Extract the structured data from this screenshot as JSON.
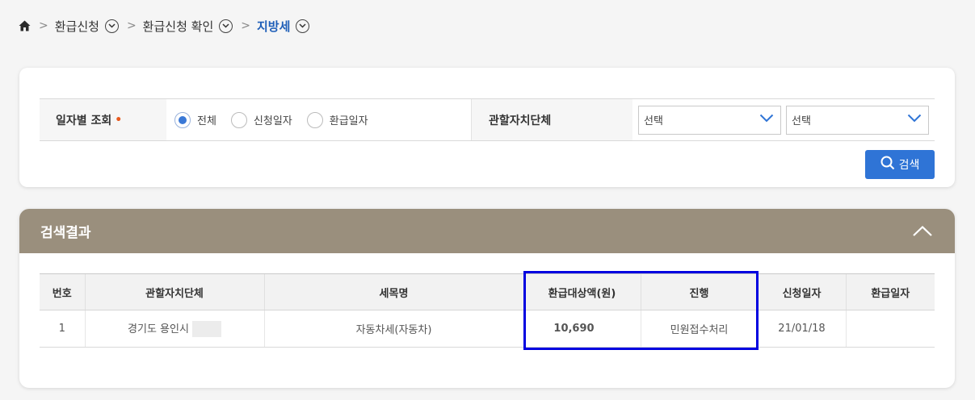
{
  "breadcrumb": {
    "home_icon": "home-icon",
    "items": [
      {
        "label": "환급신청"
      },
      {
        "label": "환급신청 확인"
      },
      {
        "label": "지방세"
      }
    ]
  },
  "search": {
    "date_label": "일자별 조회",
    "required_mark": "•",
    "radios": [
      {
        "label": "전체",
        "checked": true
      },
      {
        "label": "신청일자",
        "checked": false
      },
      {
        "label": "환급일자",
        "checked": false
      }
    ],
    "org_label": "관할자치단체",
    "select1": "선택",
    "select2": "선택",
    "search_button": "검색"
  },
  "results": {
    "title": "검색결과",
    "columns": [
      "번호",
      "관할자치단체",
      "세목명",
      "환급대상액(원)",
      "진행",
      "신청일자",
      "환급일자"
    ],
    "rows": [
      {
        "no": "1",
        "org": "경기도 용인시",
        "tax": "자동차세(자동차)",
        "amount": "10,690",
        "status": "민원접수처리",
        "apply_date": "21/01/18",
        "refund_date": ""
      }
    ]
  },
  "colors": {
    "accent": "#2f74d6",
    "header_bg": "#9a8f7d",
    "highlight": "#0000e0",
    "breadcrumb_current": "#1f5fb8"
  }
}
